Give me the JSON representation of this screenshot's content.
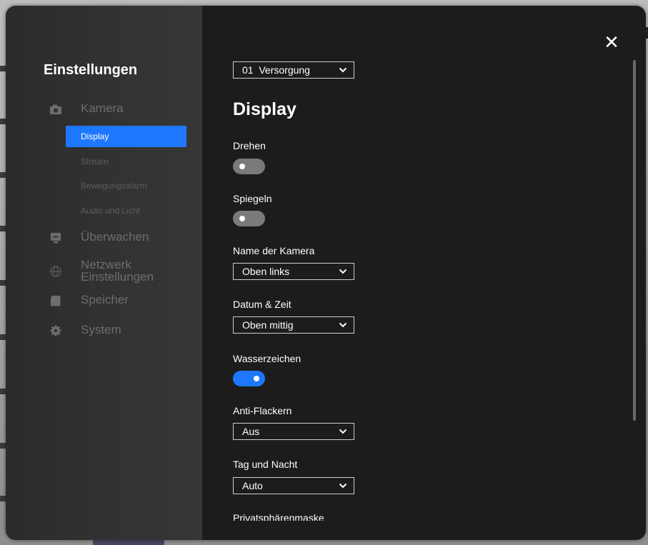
{
  "sidebar": {
    "title": "Einstellungen",
    "sections": [
      {
        "label": "Kamera",
        "icon": "camera-icon"
      },
      {
        "label": "Überwachen",
        "icon": "monitor-icon"
      },
      {
        "label": "Netzwerk Einstellungen",
        "icon": "globe-icon"
      },
      {
        "label": "Speicher",
        "icon": "sd-card-icon"
      },
      {
        "label": "System",
        "icon": "gear-icon"
      }
    ],
    "camera_subitems": [
      {
        "label": "Display",
        "active": true
      },
      {
        "label": "Stream",
        "active": false
      },
      {
        "label": "Bewegungsalarm",
        "active": false
      },
      {
        "label": "Audio und Licht",
        "active": false
      }
    ]
  },
  "content": {
    "camera_select": "01  Versorgung",
    "heading": "Display",
    "settings": {
      "rotate_label": "Drehen",
      "rotate_on": false,
      "mirror_label": "Spiegeln",
      "mirror_on": false,
      "camera_name_label": "Name der Kamera",
      "camera_name_value": "Oben links",
      "datetime_label": "Datum & Zeit",
      "datetime_value": "Oben mittig",
      "watermark_label": "Wasserzeichen",
      "watermark_on": true,
      "antiflicker_label": "Anti-Flackern",
      "antiflicker_value": "Aus",
      "daynight_label": "Tag und Nacht",
      "daynight_value": "Auto",
      "privacy_label": "Privatsphärenmaske"
    }
  },
  "colors": {
    "accent": "#1e78ff",
    "modal_bg": "#1c1c1c",
    "sidebar_bg": "#333333",
    "inactive_text": "#6d6d6d"
  }
}
